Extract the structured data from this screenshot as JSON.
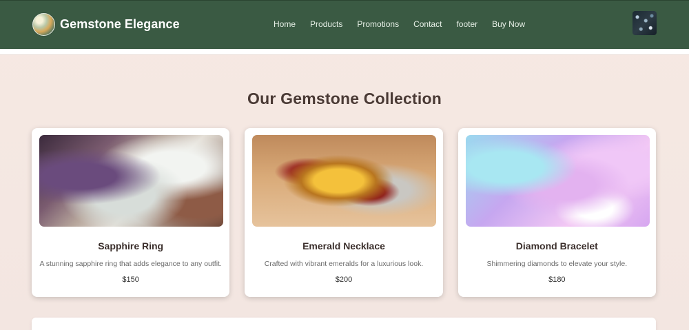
{
  "header": {
    "brand_name": "Gemstone Elegance",
    "nav": [
      "Home",
      "Products",
      "Promotions",
      "Contact",
      "footer",
      "Buy Now"
    ]
  },
  "main": {
    "title": "Our Gemstone Collection",
    "products": [
      {
        "name": "Sapphire Ring",
        "description": "A stunning sapphire ring that adds elegance to any outfit.",
        "price": "$150"
      },
      {
        "name": "Emerald Necklace",
        "description": "Crafted with vibrant emeralds for a luxurious look.",
        "price": "$200"
      },
      {
        "name": "Diamond Bracelet",
        "description": "Shimmering diamonds to elevate your style.",
        "price": "$180"
      }
    ]
  },
  "colors": {
    "header_bg": "#3a5a43",
    "page_bg": "#f6e9e3",
    "title_text": "#4a3a35"
  },
  "icons": {
    "logo": "gemstone-logo-image",
    "cart": "cart-thumbnail-image"
  }
}
